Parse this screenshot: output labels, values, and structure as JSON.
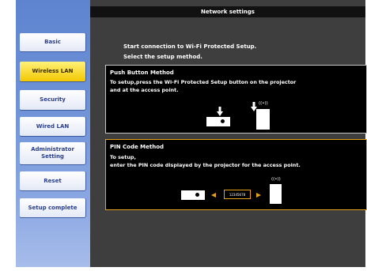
{
  "header": {
    "title": "Network settings"
  },
  "sidebar": {
    "items": [
      {
        "label": "Basic",
        "active": false
      },
      {
        "label": "Wireless LAN",
        "active": true
      },
      {
        "label": "Security",
        "active": false
      },
      {
        "label": "Wired LAN",
        "active": false
      },
      {
        "label": "Administrator Setting",
        "active": false
      },
      {
        "label": "Reset",
        "active": false
      },
      {
        "label": "Setup complete",
        "active": false
      }
    ]
  },
  "intro": {
    "line1": "Start connection to Wi-Fi Protected Setup.",
    "line2": "Select the setup method."
  },
  "push_button_method": {
    "title": "Push Button Method",
    "desc_line1": "To setup,press the Wi-Fi Protected Setup button on the projector",
    "desc_line2": "and at the access point.",
    "ap_label": "((•))"
  },
  "pin_code_method": {
    "title": "PIN Code Method",
    "desc_line1": "To setup,",
    "desc_line2": "enter the PIN code displayed by the projector for the access point.",
    "pin_code": "12345678",
    "ap_label": "((•))"
  },
  "colors": {
    "selected_border": "#e7a21a",
    "active_button": "#f3c800",
    "sidebar": "#6f92d8",
    "panel": "#3e3e3e"
  },
  "icons": [
    "projector-icon",
    "access-point-icon",
    "down-arrow-icon",
    "left-arrow-icon",
    "right-arrow-icon"
  ]
}
